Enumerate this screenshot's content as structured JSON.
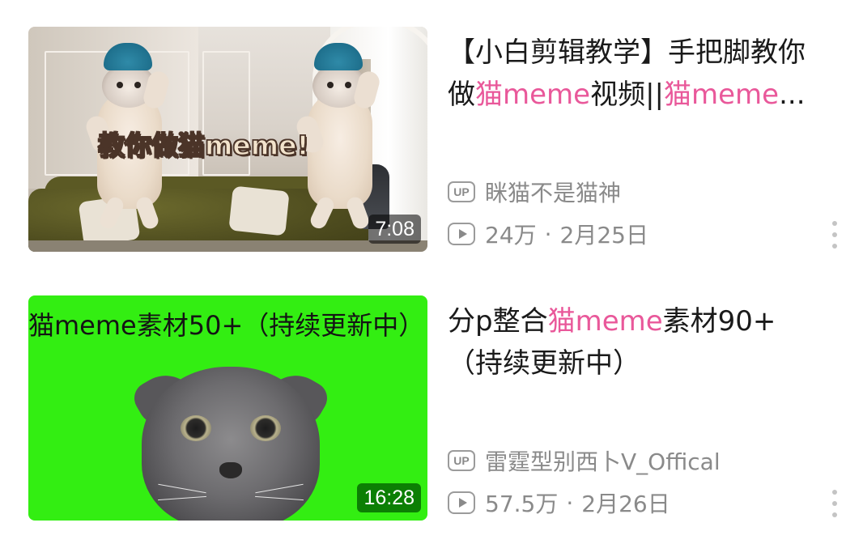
{
  "videos": [
    {
      "thumbnail": {
        "overlay_text": "教你做猫meme!",
        "duration": "7:08"
      },
      "title": {
        "line1": [
          "【小白剪辑教学】手把脚教你"
        ],
        "line2_plain_a": "做",
        "line2_hl_a": "猫",
        "line2_plain_b": "meme",
        "line2_plain_c": "视频||",
        "line2_hl_b": "猫",
        "line2_plain_d": "meme",
        "line2_end": "..."
      },
      "uploader_badge": "UP",
      "uploader": "眯猫不是猫神",
      "views": "24万",
      "separator": "·",
      "date": "2月25日"
    },
    {
      "thumbnail": {
        "caption": "猫meme素材50+（持续更新中）",
        "duration": "16:28"
      },
      "title": {
        "line1_plain_a": "分p整合",
        "line1_hl_a": "猫",
        "line1_hl_b": "meme",
        "line1_plain_b": "素材90+",
        "line2": "（持续更新中）"
      },
      "uploader_badge": "UP",
      "uploader": "雷霆型别西卜V_Offical",
      "views": "57.5万",
      "separator": "·",
      "date": "2月26日"
    }
  ],
  "colors": {
    "highlight": "#e9589a",
    "meta_gray": "#8a8a8a",
    "green_screen": "#33ee12"
  },
  "icons": {
    "up_badge": "up-badge-icon",
    "play": "play-count-icon",
    "more": "more-vertical-icon"
  }
}
